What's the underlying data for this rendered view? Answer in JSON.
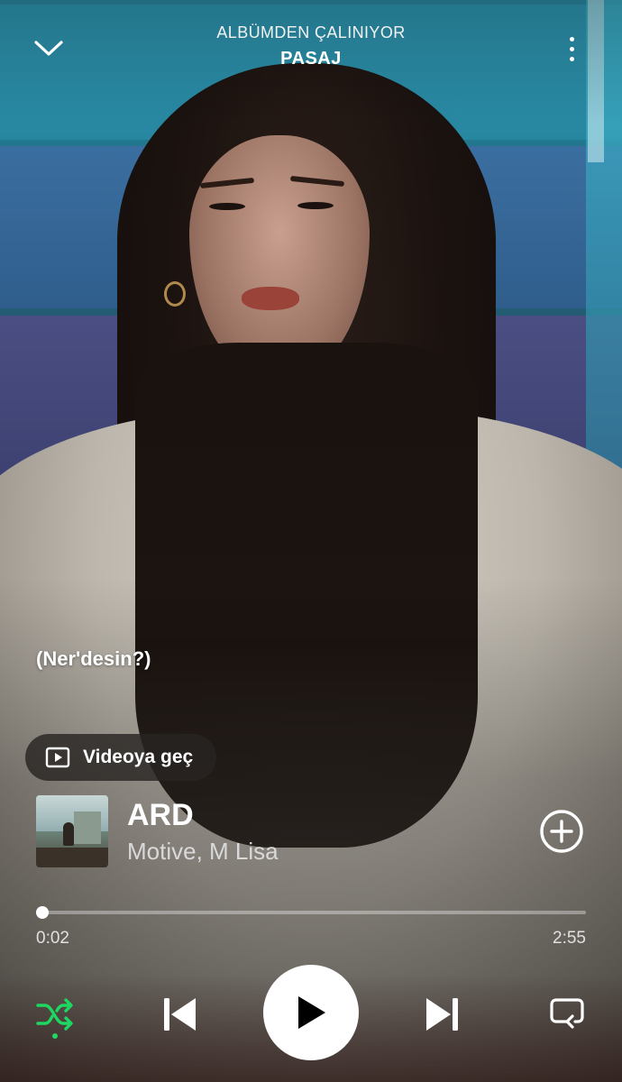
{
  "header": {
    "context_label": "ALBÜMDEN ÇALINIYOR",
    "context_name": "PASAJ",
    "collapse_icon": "chevron-down-icon",
    "more_icon": "more-vertical-icon"
  },
  "lyrics": {
    "current_line": "(Ner'desin?)"
  },
  "video_toggle": {
    "label": "Videoya geç",
    "icon": "video-play-icon"
  },
  "track": {
    "title": "ARD",
    "artists": "Motive, M Lisa",
    "cover_icon": "album-cover-image",
    "add_icon": "add-circle-icon"
  },
  "playback": {
    "elapsed": "0:02",
    "duration": "2:55",
    "progress_fraction": 0.011
  },
  "controls": {
    "shuffle_icon": "shuffle-icon",
    "shuffle_active": true,
    "previous_icon": "skip-previous-icon",
    "play_icon": "play-icon",
    "next_icon": "skip-next-icon",
    "repeat_icon": "repeat-icon"
  },
  "colors": {
    "accent": "#1ed760",
    "text": "#ffffff",
    "pill_bg": "#2a2624"
  }
}
